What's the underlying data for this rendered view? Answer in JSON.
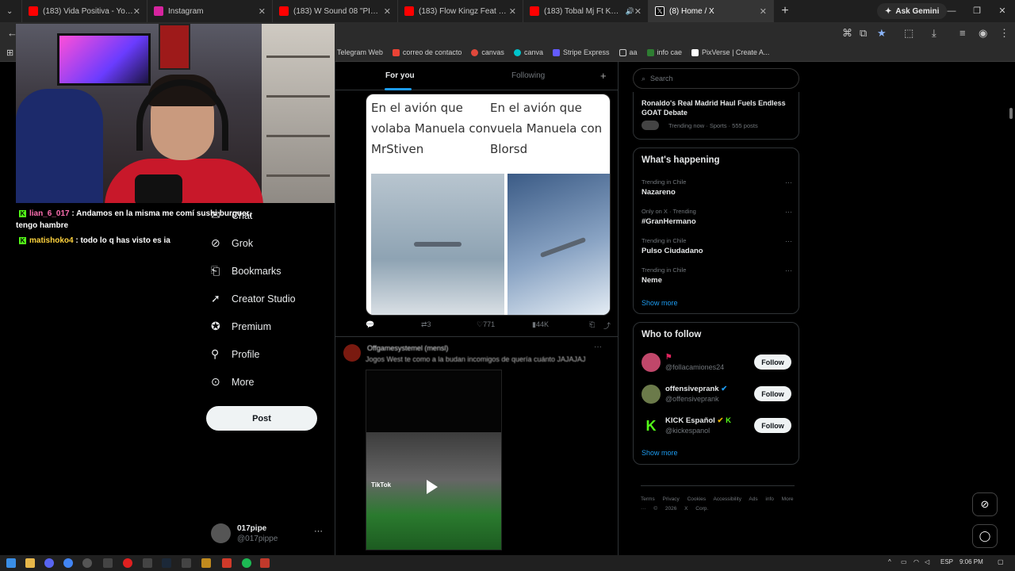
{
  "browser": {
    "tabs": [
      {
        "label": "(183) Vida Positiva - YouTube",
        "color": "#ff0000"
      },
      {
        "label": "Instagram",
        "color": "#d6249f"
      },
      {
        "label": "(183) W Sound 08 \"PICO Y CHA",
        "color": "#ff0000"
      },
      {
        "label": "(183) Flow Kingz Feat Lyng - Ky",
        "color": "#ff0000"
      },
      {
        "label": "(183) Tobal Mj Ft Kail BRL",
        "color": "#ff0000"
      },
      {
        "label": "(8) Home / X",
        "color": "#ffffff"
      }
    ],
    "new_tab": "+",
    "gemini_label": "Ask Gemini",
    "bookmarks": [
      {
        "label": "Telegram Web",
        "color": "#2aa1da"
      },
      {
        "label": "correo de contacto",
        "color": "#ea4335"
      },
      {
        "label": "canvas",
        "color": "#e0483b"
      },
      {
        "label": "canva",
        "color": "#00c4cc"
      },
      {
        "label": "Stripe Express",
        "color": "#635bff"
      },
      {
        "label": "aa",
        "color": "#cccccc"
      },
      {
        "label": "info cae",
        "color": "#2e7d32"
      },
      {
        "label": "PixVerse | Create A...",
        "color": "#ffffff"
      }
    ]
  },
  "chat": {
    "messages": [
      {
        "user": "lian_6_017",
        "text": ": Andamos en la misma me comí sushi burguer, tengo hambre"
      },
      {
        "user": "matishoko4",
        "text": ": todo lo q has visto es ia"
      }
    ]
  },
  "nav": {
    "items": [
      {
        "label": "Chat",
        "icon": "chat-icon"
      },
      {
        "label": "Grok",
        "icon": "grok-icon"
      },
      {
        "label": "Bookmarks",
        "icon": "bookmark-icon"
      },
      {
        "label": "Creator Studio",
        "icon": "rocket-icon"
      },
      {
        "label": "Premium",
        "icon": "verified-icon"
      },
      {
        "label": "Profile",
        "icon": "person-icon"
      },
      {
        "label": "More",
        "icon": "more-circle-icon"
      }
    ],
    "post_label": "Post"
  },
  "account": {
    "name": "017pipe",
    "handle": "@017pippe"
  },
  "feed": {
    "tab_for_you": "For you",
    "tab_following": "Following",
    "post1": {
      "meme_left": "En el avión que volaba Manuela con MrStiven",
      "meme_right": "En el avión que vuela Manuela con Blorsd",
      "reposts": "3",
      "likes": "771",
      "views": "44K"
    },
    "post2": {
      "author": "Offgamesystemel (mensl)",
      "text": "Jogos West te como a la budan incomigos de quería cuánto JAJAJAJ",
      "video_watermark": "TikTok"
    }
  },
  "sidebar": {
    "search_placeholder": "Search",
    "top_story": {
      "title": "Ronaldo's Real Madrid Haul Fuels Endless GOAT Debate",
      "meta": "Trending now · Sports · 555 posts"
    },
    "happening_title": "What's happening",
    "trends": [
      {
        "meta": "Trending in Chile",
        "name": "Nazareno"
      },
      {
        "meta": "Only on X · Trending",
        "name": "#GranHermano"
      },
      {
        "meta": "Trending in Chile",
        "name": "Pulso Ciudadano"
      },
      {
        "meta": "Trending in Chile",
        "name": "Neme"
      }
    ],
    "show_more": "Show more",
    "who_to_follow_title": "Who to follow",
    "suggestions": [
      {
        "name": "",
        "handle": "@follacamiones24",
        "avatar_color": "#c0476a"
      },
      {
        "name": "offensiveprank",
        "handle": "@offensiveprank",
        "avatar_color": "#6b7a4a"
      },
      {
        "name": "KICK Español",
        "handle": "@kickespanol",
        "avatar_color": "#53fc18"
      }
    ],
    "follow_label": "Follow",
    "show_more_2": "Show more",
    "footer": "Terms Privacy Cookies Accessibility Ads info More ··· © 2026 X Corp."
  },
  "taskbar": {
    "language": "ESP",
    "time": "9:06 PM"
  }
}
